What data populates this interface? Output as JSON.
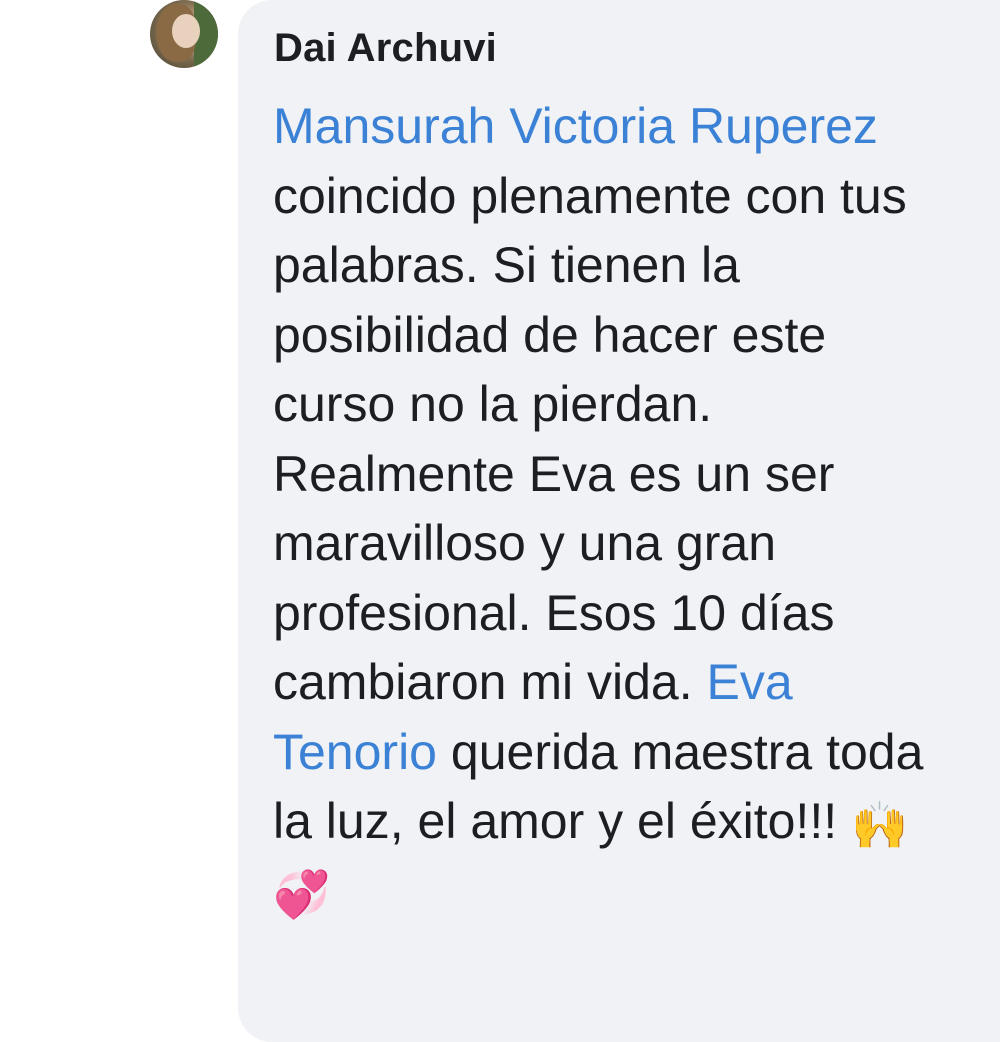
{
  "comment": {
    "author": "Dai Archuvi",
    "mention_1": "Mansurah Victoria Ruperez",
    "text_1": " coincido plenamente con tus palabras. Si tienen la posibilidad de hacer este curso no la pierdan. Realmente Eva es un ser maravilloso y una gran profesional. Esos 10 días cambiaron mi vida. ",
    "mention_2": "Eva Tenorio",
    "text_2": " querida maestra toda la luz, el amor y el éxito!!! ",
    "emoji_1": "🙌",
    "emoji_2": "💞"
  },
  "colors": {
    "bubble_background": "#f0f2f5",
    "mention": "#3b82d6",
    "text": "#1c1e21"
  },
  "icons": {
    "avatar": "profile-photo"
  }
}
